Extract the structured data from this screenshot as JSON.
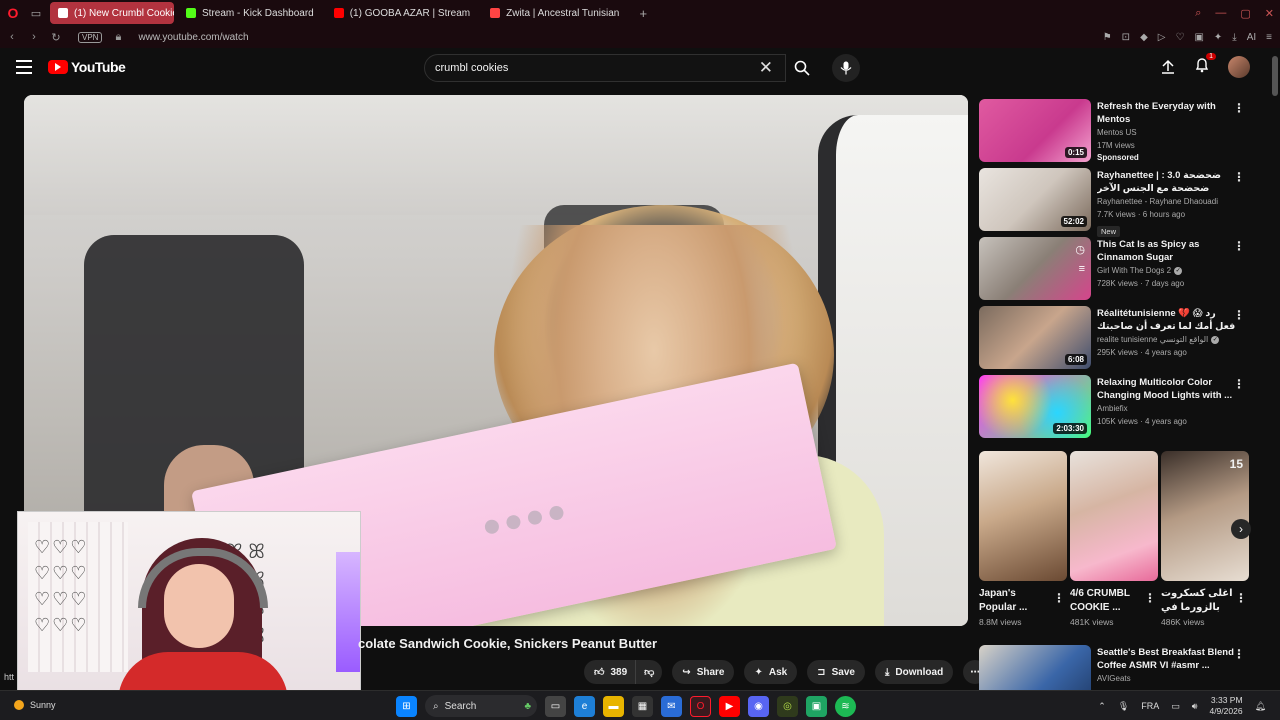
{
  "browser": {
    "tabs": [
      {
        "label": "(1) New Crumbl Cookie",
        "active": true,
        "color": "#ff0000"
      },
      {
        "label": "Stream - Kick Dashboard",
        "active": false,
        "color": "#53fc18"
      },
      {
        "label": "(1) GOOBA AZAR | Stream",
        "active": false,
        "color": "#ff0000"
      },
      {
        "label": "Zwita | Ancestral Tunisian",
        "active": false,
        "color": "#ff4444"
      }
    ],
    "vpn_label": "VPN",
    "url": "www.youtube.com/watch",
    "ai_label": "AI"
  },
  "header": {
    "logo_text": "YouTube",
    "search_query": "crumbl cookies",
    "notification_count": "1"
  },
  "video": {
    "title": "colate Sandwich Cookie, Snickers Peanut Butter",
    "like_count": "389",
    "actions": {
      "share": "Share",
      "ask": "Ask",
      "save": "Save",
      "download": "Download"
    }
  },
  "status_url": "htt",
  "recommendations": [
    {
      "title": "Refresh the Everyday with Mentos",
      "channel": "Mentos US",
      "stats": "17M views",
      "badge": "Sponsored",
      "duration": "0:15"
    },
    {
      "title": "Rayhanettee | ضحضحة 3.0 : ضحضحة مع الجنس الآخر",
      "channel": "Rayhanettee - Rayhane Dhaouadi",
      "stats": "7.7K views · 6 hours ago",
      "badge": "New",
      "duration": "52:02"
    },
    {
      "title": "This Cat Is as Spicy as Cinnamon Sugar",
      "channel": "Girl With The Dogs 2",
      "stats": "728K views · 7 days ago",
      "badge": "",
      "duration": ""
    },
    {
      "title": "Réalitétunisienne 💔 😱 رد فعل أمك لما تعرف أن صاحبتك حامل منك",
      "channel": "realite tunisienne الواقع التونسي",
      "stats": "295K views · 4 years ago",
      "badge": "",
      "duration": "6:08"
    },
    {
      "title": "Relaxing Multicolor Color Changing Mood Lights with ...",
      "channel": "Ambiefix",
      "stats": "105K views · 4 years ago",
      "badge": "",
      "duration": "2:03:30"
    }
  ],
  "shorts": [
    {
      "title": "Japan's Popular ...",
      "views": "8.8M views"
    },
    {
      "title": "4/6 CRUMBL COOKIE ...",
      "views": "481K views"
    },
    {
      "title": "اغلى كسكروت بالزورما في تونس...",
      "views": "486K views"
    }
  ],
  "shorts_overlay_number": "15",
  "last_rec": {
    "title": "Seattle's Best Breakfast Blend Coffee ASMR VI #asmr ...",
    "channel": "AVIGeats"
  },
  "facecam": {
    "hearts": "♡♡♡\n♡♡♡\n♡♡♡\n♡♡♡",
    "bows": "🎀\n🎀\n🎀\n🎀"
  },
  "taskbar": {
    "weather": "Sunny",
    "search": "Search",
    "lang": "FRA",
    "time": "3:33 PM",
    "date": "4/9/2026"
  },
  "colors": {
    "accent": "#ff0000",
    "tab_active": "#b2333f"
  }
}
